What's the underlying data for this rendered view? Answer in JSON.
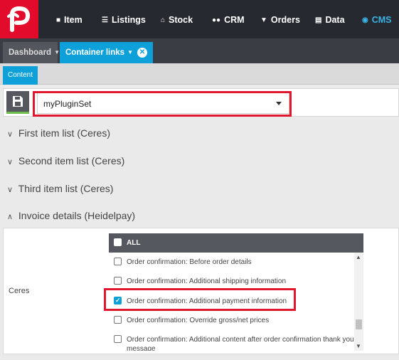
{
  "nav": {
    "items": [
      {
        "label": "Item",
        "icon": "tag-icon"
      },
      {
        "label": "Listings",
        "icon": "list-icon"
      },
      {
        "label": "Stock",
        "icon": "warehouse-icon"
      },
      {
        "label": "CRM",
        "icon": "users-icon"
      },
      {
        "label": "Orders",
        "icon": "cart-icon"
      },
      {
        "label": "Data",
        "icon": "data-icon"
      },
      {
        "label": "CMS",
        "icon": "cms-icon",
        "active": true
      }
    ]
  },
  "tabs": {
    "dashboard": "Dashboard",
    "container_links": "Container links"
  },
  "subtab": "Content",
  "plugin_set": {
    "selected": "myPluginSet"
  },
  "sections": [
    {
      "label": "First item list (Ceres)",
      "state": "collapsed"
    },
    {
      "label": "Second item list (Ceres)",
      "state": "collapsed"
    },
    {
      "label": "Third item list (Ceres)",
      "state": "collapsed"
    },
    {
      "label": "Invoice details (Heidelpay)",
      "state": "expanded"
    }
  ],
  "panel": {
    "label": "Ceres",
    "all_label": "ALL",
    "options": [
      {
        "label": "Order confirmation: Before order details",
        "checked": false
      },
      {
        "label": "Order confirmation: Additional shipping information",
        "checked": false
      },
      {
        "label": "Order confirmation: Additional payment information",
        "checked": true
      },
      {
        "label": "Order confirmation: Override gross/net prices",
        "checked": false
      },
      {
        "label": "Order confirmation: Additional content after order confirmation thank you message",
        "checked": false
      }
    ]
  },
  "colors": {
    "brand_red": "#e30b2c",
    "accent_blue": "#0ea0d8",
    "highlight_red": "#e0182f"
  }
}
